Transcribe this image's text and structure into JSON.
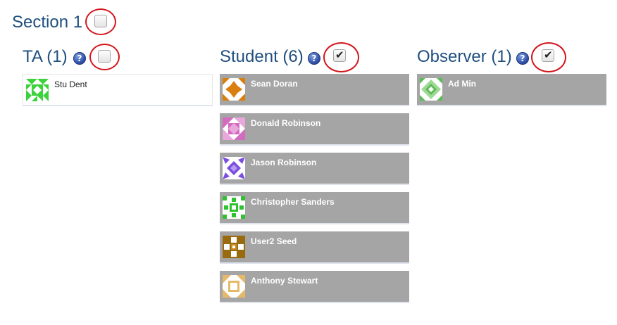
{
  "section": {
    "title": "Section 1",
    "checked": false
  },
  "columns": [
    {
      "title": "TA (1)",
      "help": "?",
      "checked": false,
      "members": [
        {
          "name": "Stu Dent",
          "avatar": "green-quilt-avatar"
        }
      ]
    },
    {
      "title": "Student (6)",
      "help": "?",
      "checked": true,
      "members": [
        {
          "name": "Sean Doran",
          "avatar": "orange-quilt-avatar"
        },
        {
          "name": "Donald Robinson",
          "avatar": "pink-quilt-avatar"
        },
        {
          "name": "Jason Robinson",
          "avatar": "purple-quilt-avatar"
        },
        {
          "name": "Christopher Sanders",
          "avatar": "green-cross-avatar"
        },
        {
          "name": "User2 Seed",
          "avatar": "brown-cross-avatar"
        },
        {
          "name": "Anthony Stewart",
          "avatar": "tan-quilt-avatar"
        }
      ]
    },
    {
      "title": "Observer (1)",
      "help": "?",
      "checked": true,
      "members": [
        {
          "name": "Ad Min",
          "avatar": "green-diamond-avatar"
        }
      ]
    }
  ],
  "colors": {
    "heading": "#1f4f7f",
    "ring": "#d4141b",
    "card_selected": "#a5a5a5",
    "card_unselected": "#ffffff"
  }
}
